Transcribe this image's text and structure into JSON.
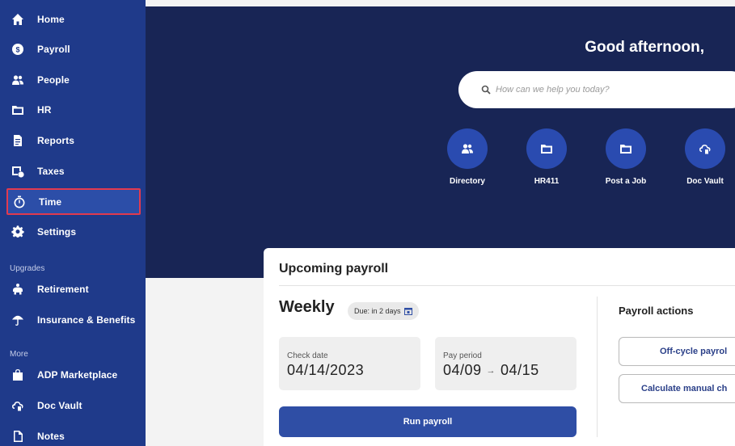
{
  "sidebar": {
    "items": [
      {
        "label": "Home",
        "icon": "home-icon"
      },
      {
        "label": "Payroll",
        "icon": "dollar-icon"
      },
      {
        "label": "People",
        "icon": "people-icon"
      },
      {
        "label": "HR",
        "icon": "folder-icon"
      },
      {
        "label": "Reports",
        "icon": "report-icon"
      },
      {
        "label": "Taxes",
        "icon": "taxes-icon"
      },
      {
        "label": "Time",
        "icon": "clock-icon",
        "selected": true
      },
      {
        "label": "Settings",
        "icon": "gear-icon"
      }
    ],
    "upgrades_label": "Upgrades",
    "upgrades": [
      {
        "label": "Retirement",
        "icon": "piggy-bank-icon"
      },
      {
        "label": "Insurance & Benefits",
        "icon": "umbrella-icon"
      }
    ],
    "more_label": "More",
    "more": [
      {
        "label": "ADP Marketplace",
        "icon": "shopping-bag-icon"
      },
      {
        "label": "Doc Vault",
        "icon": "cloud-lock-icon"
      },
      {
        "label": "Notes",
        "icon": "note-icon"
      }
    ]
  },
  "hero": {
    "greeting": "Good afternoon,",
    "search_placeholder": "How can we help you today?",
    "quick_links": [
      {
        "label": "Directory",
        "icon": "people-icon"
      },
      {
        "label": "HR411",
        "icon": "folder-icon"
      },
      {
        "label": "Post a Job",
        "icon": "folder-icon"
      },
      {
        "label": "Doc Vault",
        "icon": "cloud-lock-icon"
      }
    ]
  },
  "payroll": {
    "title": "Upcoming payroll",
    "frequency": "Weekly",
    "due": "Due: in 2 days",
    "check_date_label": "Check date",
    "check_date": "04/14/2023",
    "pay_period_label": "Pay period",
    "pay_period_start": "04/09",
    "pay_period_end": "04/15",
    "run_button": "Run payroll",
    "actions_title": "Payroll actions",
    "action_offcycle": "Off-cycle payrol",
    "action_manual": "Calculate manual ch"
  },
  "colors": {
    "sidebar_bg": "#1f3a8a",
    "hero_bg": "#182555",
    "accent": "#2f4ea5",
    "selection_border": "#e23a4e"
  }
}
